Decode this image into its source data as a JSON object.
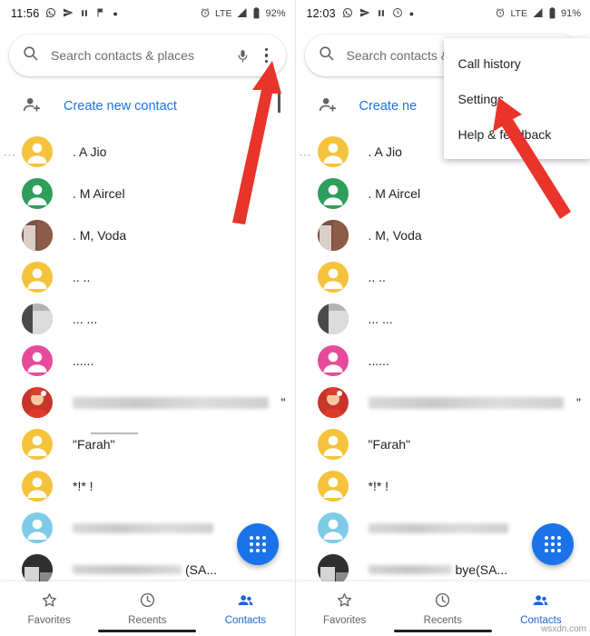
{
  "screens": [
    {
      "id": "left",
      "status": {
        "clock": "11:56",
        "left_icons": [
          "whatsapp-icon",
          "send-icon",
          "pause-icon",
          "flag-icon",
          "dot-icon"
        ],
        "right_icons": [
          "alarm-icon",
          "lte-label",
          "signal-icon",
          "battery-icon"
        ],
        "network": "LTE",
        "battery": "92%"
      },
      "search": {
        "placeholder": "Search contacts & places",
        "mic_label": "mic-icon",
        "overflow_label": "more-options"
      },
      "create_contact_label": "Create new contact",
      "contacts": [
        {
          "name": ". A Jio",
          "avatar": "yellow",
          "blurred": false
        },
        {
          "name": ". M Aircel",
          "avatar": "green",
          "blurred": false
        },
        {
          "name": ". M, Voda",
          "avatar": "photo-brown",
          "blurred": false
        },
        {
          "name": ".. ..",
          "avatar": "yellow",
          "blurred": false
        },
        {
          "name": "... ...",
          "avatar": "photo-gray",
          "blurred": false
        },
        {
          "name": "......",
          "avatar": "pink",
          "blurred": false
        },
        {
          "name": "",
          "avatar": "photo-santa",
          "blurred": true
        },
        {
          "name": "\"Farah\"",
          "avatar": "yellow",
          "blurred": false
        },
        {
          "name": "*!* !",
          "avatar": "yellow",
          "blurred": false
        },
        {
          "name": "",
          "avatar": "lightblue",
          "blurred": true
        },
        {
          "name": "(SA...",
          "avatar": "photo-dark",
          "blurred": true
        }
      ],
      "bottom_nav": [
        {
          "label": "Favorites",
          "icon": "star-icon",
          "active": false
        },
        {
          "label": "Recents",
          "icon": "clock-icon",
          "active": false
        },
        {
          "label": "Contacts",
          "icon": "contacts-icon",
          "active": true
        }
      ],
      "fab_label": "dialpad-icon",
      "popup": null
    },
    {
      "id": "right",
      "status": {
        "clock": "12:03",
        "left_icons": [
          "whatsapp-icon",
          "send-icon",
          "pause-icon",
          "clock-icon",
          "dot-icon"
        ],
        "right_icons": [
          "alarm-icon",
          "lte-label",
          "signal-icon",
          "battery-icon"
        ],
        "network": "LTE",
        "battery": "91%"
      },
      "search": {
        "placeholder": "Search contacts &",
        "mic_label": "mic-icon",
        "overflow_label": "more-options"
      },
      "create_contact_label": "Create ne",
      "contacts": [
        {
          "name": ". A Jio",
          "avatar": "yellow",
          "blurred": false
        },
        {
          "name": ". M Aircel",
          "avatar": "green",
          "blurred": false
        },
        {
          "name": ". M, Voda",
          "avatar": "photo-brown",
          "blurred": false
        },
        {
          "name": ".. ..",
          "avatar": "yellow",
          "blurred": false
        },
        {
          "name": "... ...",
          "avatar": "photo-gray",
          "blurred": false
        },
        {
          "name": "......",
          "avatar": "pink",
          "blurred": false
        },
        {
          "name": "",
          "avatar": "photo-santa",
          "blurred": true
        },
        {
          "name": "\"Farah\"",
          "avatar": "yellow",
          "blurred": false
        },
        {
          "name": "*!* !",
          "avatar": "yellow",
          "blurred": false
        },
        {
          "name": "",
          "avatar": "lightblue",
          "blurred": true
        },
        {
          "name": "bye(SA...",
          "avatar": "photo-dark",
          "blurred": true
        }
      ],
      "bottom_nav": [
        {
          "label": "Favorites",
          "icon": "star-icon",
          "active": false
        },
        {
          "label": "Recents",
          "icon": "clock-icon",
          "active": false
        },
        {
          "label": "Contacts",
          "icon": "contacts-icon",
          "active": true
        }
      ],
      "fab_label": "dialpad-icon",
      "popup": {
        "items": [
          "Call history",
          "Settings",
          "Help & feedback"
        ]
      }
    }
  ],
  "annotations": {
    "arrow_color": "#e8342a",
    "watermark": "wsxdn.com"
  },
  "colors": {
    "accent_blue": "#1a73e8",
    "avatar_yellow": "#f5c33b",
    "avatar_green": "#2e9e5b",
    "avatar_pink": "#e84a9b",
    "avatar_lightblue": "#7ecbe8",
    "nav_active": "#1967d2",
    "text_primary": "#202124",
    "text_secondary": "#5f6368"
  }
}
